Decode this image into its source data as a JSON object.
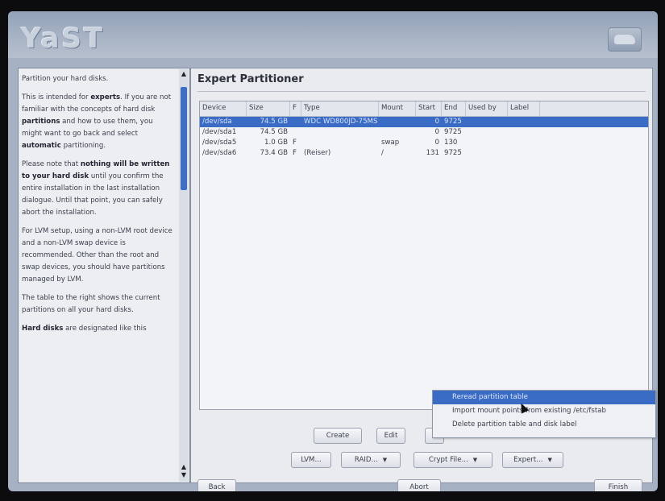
{
  "app": {
    "logo": "YaST"
  },
  "help": {
    "title": "Partition your hard disks.",
    "p1_pre": "This is intended for ",
    "p1_b1": "experts",
    "p1_mid": ". If you are not familiar with the concepts of hard disk ",
    "p1_b2": "partitions",
    "p1_mid2": " and how to use them, you might want to go back and select ",
    "p1_b3": "automatic",
    "p1_post": " partitioning.",
    "p2_pre": "Please note that ",
    "p2_b": "nothing will be written to your hard disk",
    "p2_post": " until you confirm the entire installation in the last installation dialogue. Until that point, you can safely abort the installation.",
    "p3": "For LVM setup, using a non-LVM root device and a non-LVM swap device is recommended. Other than the root and swap devices, you should have partitions managed by LVM.",
    "p4": "The table to the right shows the current partitions on all your hard disks.",
    "p5_b": "Hard disks",
    "p5_post": " are designated like this"
  },
  "main": {
    "title": "Expert Partitioner",
    "columns": [
      "Device",
      "Size",
      "F",
      "Type",
      "Mount",
      "Start",
      "End",
      "Used by",
      "Label"
    ],
    "rows": [
      {
        "device": "/dev/sda",
        "size": "74.5 GB",
        "f": "",
        "type": "WDC WD800JD-75MS",
        "mount": "",
        "start": "0",
        "end": "9725",
        "used": "",
        "label": ""
      },
      {
        "device": "/dev/sda1",
        "size": "74.5 GB",
        "f": "",
        "type": "",
        "mount": "",
        "start": "0",
        "end": "9725",
        "used": "",
        "label": ""
      },
      {
        "device": "/dev/sda5",
        "size": "1.0 GB",
        "f": "F",
        "type": "",
        "mount": "swap",
        "start": "0",
        "end": "130",
        "used": "",
        "label": ""
      },
      {
        "device": "/dev/sda6",
        "size": "73.4 GB",
        "f": "F",
        "type": "(Reiser)",
        "mount": "/",
        "start": "131",
        "end": "9725",
        "used": "",
        "label": ""
      }
    ]
  },
  "buttons": {
    "create": "Create",
    "edit": "Edit",
    "delete_partial": "D",
    "lvm": "LVM...",
    "raid": "RAID...",
    "crypt": "Crypt File...",
    "expert": "Expert...",
    "back": "Back",
    "abort": "Abort",
    "finish": "Finish"
  },
  "expert_menu": [
    "Reread partition table",
    "Import mount points from existing /etc/fstab",
    "Delete partition table and disk label"
  ],
  "colors": {
    "selection": "#3a6cc6",
    "scroll_thumb": "#3f6dc1"
  }
}
